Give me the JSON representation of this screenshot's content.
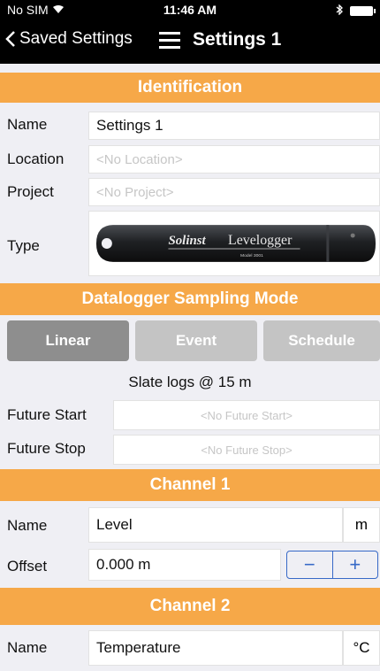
{
  "status_bar": {
    "carrier": "No SIM",
    "time": "11:46 AM"
  },
  "nav": {
    "back_label": "Saved Settings",
    "title": "Settings 1"
  },
  "identification": {
    "header": "Identification",
    "name_label": "Name",
    "name_value": "Settings 1",
    "location_label": "Location",
    "location_placeholder": "<No Location>",
    "project_label": "Project",
    "project_placeholder": "<No Project>",
    "type_label": "Type",
    "device_brand": "Solinst",
    "device_name": "Levelogger",
    "device_model": "Model 3001"
  },
  "sampling": {
    "header": "Datalogger Sampling Mode",
    "tabs": [
      {
        "label": "Linear"
      },
      {
        "label": "Event"
      },
      {
        "label": "Schedule"
      }
    ],
    "summary": "Slate logs @ 15 m",
    "future_start_label": "Future Start",
    "future_start_placeholder": "<No Future Start>",
    "future_stop_label": "Future Stop",
    "future_stop_placeholder": "<No Future Stop>"
  },
  "channel1": {
    "header": "Channel 1",
    "name_label": "Name",
    "name_value": "Level",
    "unit": "m",
    "offset_label": "Offset",
    "offset_value": "0.000 m",
    "minus": "−",
    "plus": "+"
  },
  "channel2": {
    "header": "Channel 2",
    "name_label": "Name",
    "name_value": "Temperature",
    "unit": "°C"
  }
}
